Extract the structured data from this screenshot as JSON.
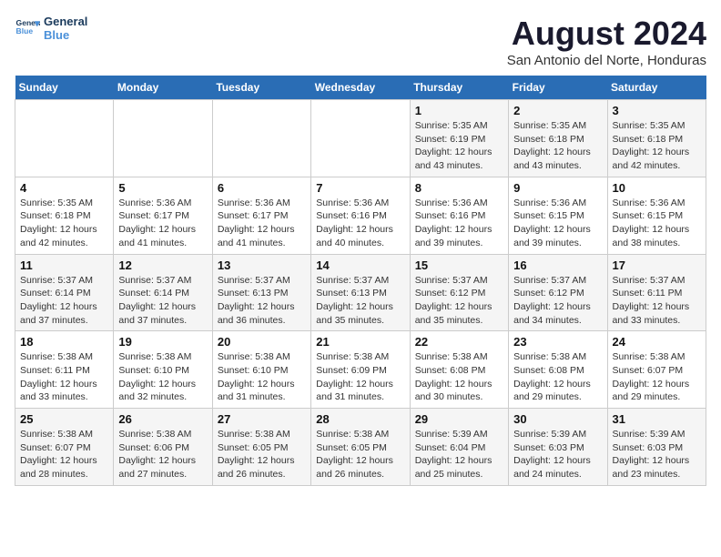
{
  "header": {
    "logo_line1": "General",
    "logo_line2": "Blue",
    "title": "August 2024",
    "subtitle": "San Antonio del Norte, Honduras"
  },
  "weekdays": [
    "Sunday",
    "Monday",
    "Tuesday",
    "Wednesday",
    "Thursday",
    "Friday",
    "Saturday"
  ],
  "weeks": [
    [
      {
        "day": "",
        "info": ""
      },
      {
        "day": "",
        "info": ""
      },
      {
        "day": "",
        "info": ""
      },
      {
        "day": "",
        "info": ""
      },
      {
        "day": "1",
        "info": "Sunrise: 5:35 AM\nSunset: 6:19 PM\nDaylight: 12 hours\nand 43 minutes."
      },
      {
        "day": "2",
        "info": "Sunrise: 5:35 AM\nSunset: 6:18 PM\nDaylight: 12 hours\nand 43 minutes."
      },
      {
        "day": "3",
        "info": "Sunrise: 5:35 AM\nSunset: 6:18 PM\nDaylight: 12 hours\nand 42 minutes."
      }
    ],
    [
      {
        "day": "4",
        "info": "Sunrise: 5:35 AM\nSunset: 6:18 PM\nDaylight: 12 hours\nand 42 minutes."
      },
      {
        "day": "5",
        "info": "Sunrise: 5:36 AM\nSunset: 6:17 PM\nDaylight: 12 hours\nand 41 minutes."
      },
      {
        "day": "6",
        "info": "Sunrise: 5:36 AM\nSunset: 6:17 PM\nDaylight: 12 hours\nand 41 minutes."
      },
      {
        "day": "7",
        "info": "Sunrise: 5:36 AM\nSunset: 6:16 PM\nDaylight: 12 hours\nand 40 minutes."
      },
      {
        "day": "8",
        "info": "Sunrise: 5:36 AM\nSunset: 6:16 PM\nDaylight: 12 hours\nand 39 minutes."
      },
      {
        "day": "9",
        "info": "Sunrise: 5:36 AM\nSunset: 6:15 PM\nDaylight: 12 hours\nand 39 minutes."
      },
      {
        "day": "10",
        "info": "Sunrise: 5:36 AM\nSunset: 6:15 PM\nDaylight: 12 hours\nand 38 minutes."
      }
    ],
    [
      {
        "day": "11",
        "info": "Sunrise: 5:37 AM\nSunset: 6:14 PM\nDaylight: 12 hours\nand 37 minutes."
      },
      {
        "day": "12",
        "info": "Sunrise: 5:37 AM\nSunset: 6:14 PM\nDaylight: 12 hours\nand 37 minutes."
      },
      {
        "day": "13",
        "info": "Sunrise: 5:37 AM\nSunset: 6:13 PM\nDaylight: 12 hours\nand 36 minutes."
      },
      {
        "day": "14",
        "info": "Sunrise: 5:37 AM\nSunset: 6:13 PM\nDaylight: 12 hours\nand 35 minutes."
      },
      {
        "day": "15",
        "info": "Sunrise: 5:37 AM\nSunset: 6:12 PM\nDaylight: 12 hours\nand 35 minutes."
      },
      {
        "day": "16",
        "info": "Sunrise: 5:37 AM\nSunset: 6:12 PM\nDaylight: 12 hours\nand 34 minutes."
      },
      {
        "day": "17",
        "info": "Sunrise: 5:37 AM\nSunset: 6:11 PM\nDaylight: 12 hours\nand 33 minutes."
      }
    ],
    [
      {
        "day": "18",
        "info": "Sunrise: 5:38 AM\nSunset: 6:11 PM\nDaylight: 12 hours\nand 33 minutes."
      },
      {
        "day": "19",
        "info": "Sunrise: 5:38 AM\nSunset: 6:10 PM\nDaylight: 12 hours\nand 32 minutes."
      },
      {
        "day": "20",
        "info": "Sunrise: 5:38 AM\nSunset: 6:10 PM\nDaylight: 12 hours\nand 31 minutes."
      },
      {
        "day": "21",
        "info": "Sunrise: 5:38 AM\nSunset: 6:09 PM\nDaylight: 12 hours\nand 31 minutes."
      },
      {
        "day": "22",
        "info": "Sunrise: 5:38 AM\nSunset: 6:08 PM\nDaylight: 12 hours\nand 30 minutes."
      },
      {
        "day": "23",
        "info": "Sunrise: 5:38 AM\nSunset: 6:08 PM\nDaylight: 12 hours\nand 29 minutes."
      },
      {
        "day": "24",
        "info": "Sunrise: 5:38 AM\nSunset: 6:07 PM\nDaylight: 12 hours\nand 29 minutes."
      }
    ],
    [
      {
        "day": "25",
        "info": "Sunrise: 5:38 AM\nSunset: 6:07 PM\nDaylight: 12 hours\nand 28 minutes."
      },
      {
        "day": "26",
        "info": "Sunrise: 5:38 AM\nSunset: 6:06 PM\nDaylight: 12 hours\nand 27 minutes."
      },
      {
        "day": "27",
        "info": "Sunrise: 5:38 AM\nSunset: 6:05 PM\nDaylight: 12 hours\nand 26 minutes."
      },
      {
        "day": "28",
        "info": "Sunrise: 5:38 AM\nSunset: 6:05 PM\nDaylight: 12 hours\nand 26 minutes."
      },
      {
        "day": "29",
        "info": "Sunrise: 5:39 AM\nSunset: 6:04 PM\nDaylight: 12 hours\nand 25 minutes."
      },
      {
        "day": "30",
        "info": "Sunrise: 5:39 AM\nSunset: 6:03 PM\nDaylight: 12 hours\nand 24 minutes."
      },
      {
        "day": "31",
        "info": "Sunrise: 5:39 AM\nSunset: 6:03 PM\nDaylight: 12 hours\nand 23 minutes."
      }
    ]
  ]
}
